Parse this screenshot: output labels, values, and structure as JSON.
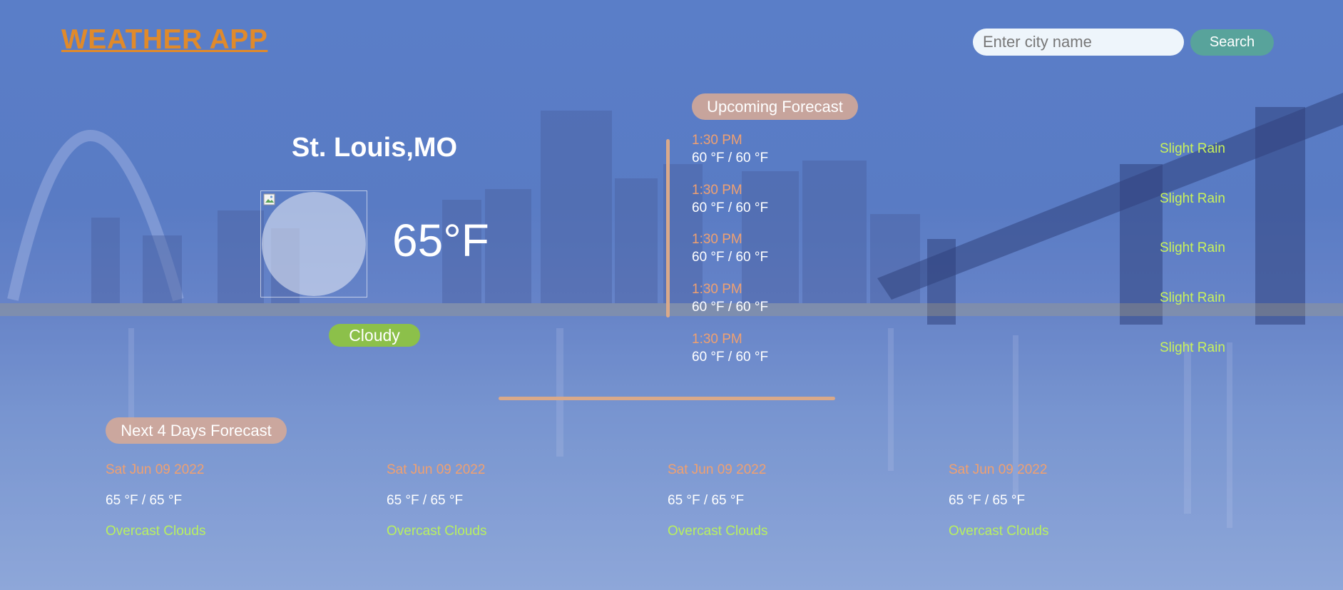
{
  "app": {
    "title": "WEATHER APP"
  },
  "search": {
    "placeholder": "Enter city name",
    "value": "",
    "button_label": "Search"
  },
  "current": {
    "city": "St. Louis,MO",
    "temperature": "65°F",
    "condition": "Cloudy"
  },
  "upcoming": {
    "heading": "Upcoming Forecast",
    "items": [
      {
        "time": "1:30 PM",
        "range": "60 °F / 60 °F",
        "description": "Slight Rain"
      },
      {
        "time": "1:30 PM",
        "range": "60 °F / 60 °F",
        "description": "Slight Rain"
      },
      {
        "time": "1:30 PM",
        "range": "60 °F / 60 °F",
        "description": "Slight Rain"
      },
      {
        "time": "1:30 PM",
        "range": "60 °F / 60 °F",
        "description": "Slight Rain"
      },
      {
        "time": "1:30 PM",
        "range": "60 °F / 60 °F",
        "description": "Slight Rain"
      }
    ]
  },
  "next_days": {
    "heading": "Next 4 Days Forecast",
    "items": [
      {
        "date": "Sat Jun 09 2022",
        "range": "65 °F / 65 °F",
        "description": "Overcast Clouds"
      },
      {
        "date": "Sat Jun 09 2022",
        "range": "65 °F / 65 °F",
        "description": "Overcast Clouds"
      },
      {
        "date": "Sat Jun 09 2022",
        "range": "65 °F / 65 °F",
        "description": "Overcast Clouds"
      },
      {
        "date": "Sat Jun 09 2022",
        "range": "65 °F / 65 °F",
        "description": "Overcast Clouds"
      }
    ]
  },
  "colors": {
    "brand": "#e08a2b",
    "search_button": "#58a39b",
    "condition_badge": "#8cc04a",
    "section_pill": "#d6aa96",
    "time_text": "#f0a070",
    "description_text": "#c8f25a",
    "divider": "#d9a98a"
  },
  "icons": {
    "weather_image": "broken-image-icon"
  }
}
